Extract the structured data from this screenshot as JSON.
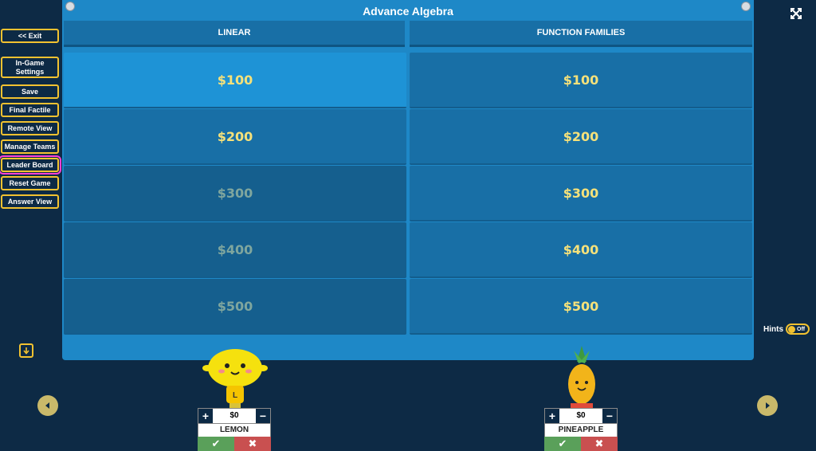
{
  "board": {
    "title": "Advance Algebra"
  },
  "sidebar": {
    "buttons": [
      {
        "label": "<< Exit"
      },
      {
        "label": "In-Game Settings"
      },
      {
        "label": "Save"
      },
      {
        "label": "Final Factile"
      },
      {
        "label": "Remote View"
      },
      {
        "label": "Manage Teams"
      },
      {
        "label": "Leader Board"
      },
      {
        "label": "Reset Game"
      },
      {
        "label": "Answer View"
      }
    ]
  },
  "categories": [
    {
      "name": "LINEAR",
      "tiles": [
        {
          "value": "$100",
          "state": "active"
        },
        {
          "value": "$200",
          "state": "open"
        },
        {
          "value": "$300",
          "state": "used"
        },
        {
          "value": "$400",
          "state": "used"
        },
        {
          "value": "$500",
          "state": "used"
        }
      ]
    },
    {
      "name": "FUNCTION FAMILIES",
      "tiles": [
        {
          "value": "$100",
          "state": "open"
        },
        {
          "value": "$200",
          "state": "open"
        },
        {
          "value": "$300",
          "state": "open"
        },
        {
          "value": "$400",
          "state": "open"
        },
        {
          "value": "$500",
          "state": "open"
        }
      ]
    }
  ],
  "hints": {
    "label": "Hints",
    "state": "Off"
  },
  "teams": [
    {
      "name": "LEMON",
      "score": "$0",
      "avatar_icon": "lemon-avatar",
      "avatar_letter": "L"
    },
    {
      "name": "PINEAPPLE",
      "score": "$0",
      "avatar_icon": "pineapple-avatar"
    }
  ],
  "icons": {
    "plus": "+",
    "minus": "−",
    "check": "✔",
    "cross": "✖"
  },
  "colors": {
    "accent": "#f2c230",
    "highlight": "#ff40d6",
    "board": "#1e88c7",
    "tile_text": "#f5e17a"
  }
}
